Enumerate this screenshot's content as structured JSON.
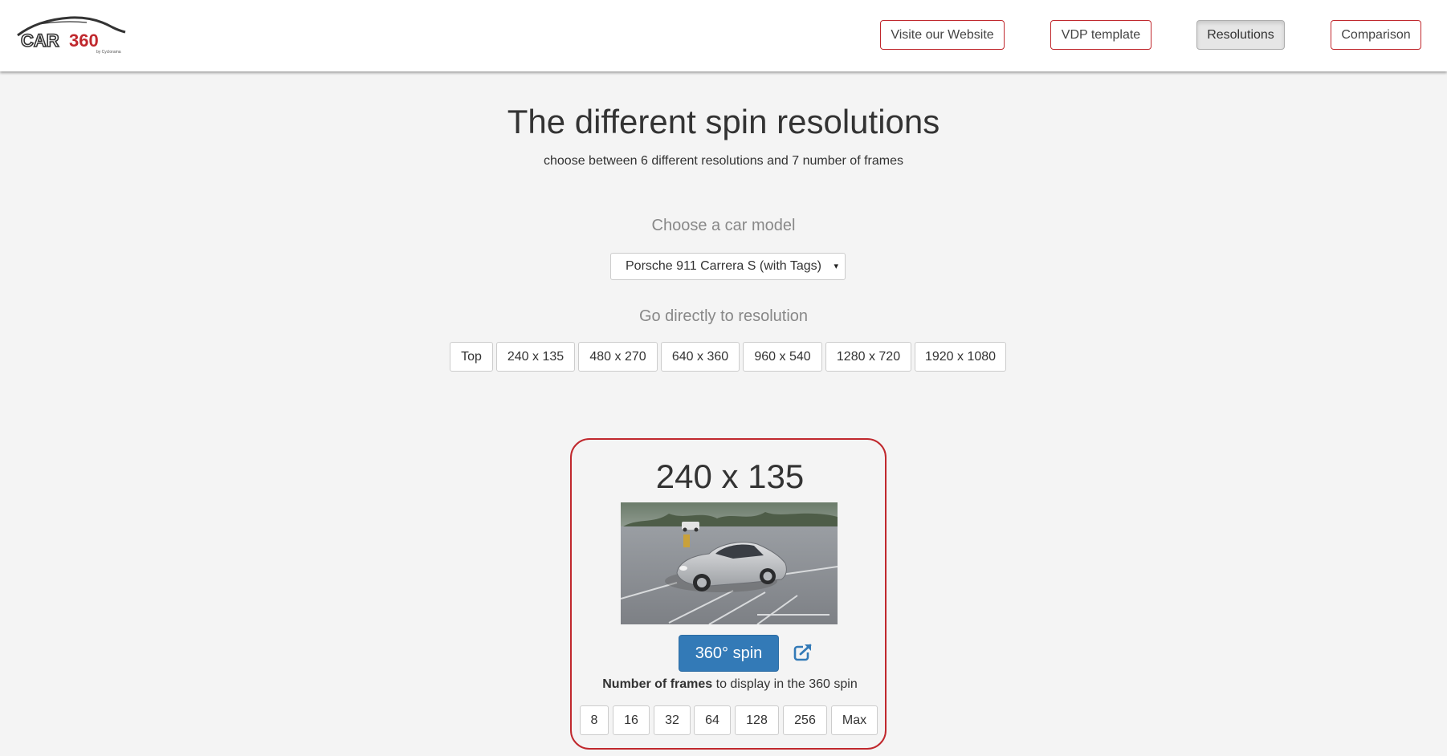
{
  "header": {
    "logo": {
      "text_car": "CAR",
      "text_360": "360",
      "byline": "by Cyclorama",
      "colors": {
        "dark": "#333333",
        "red": "#c0282d"
      }
    },
    "nav": [
      {
        "label": "Visite our Website",
        "active": false
      },
      {
        "label": "VDP template",
        "active": false
      },
      {
        "label": "Resolutions",
        "active": true
      },
      {
        "label": "Comparison",
        "active": false
      }
    ]
  },
  "main": {
    "title": "The different spin resolutions",
    "subtitle": "choose between 6 different resolutions and 7 number of frames",
    "model_label": "Choose a car model",
    "model_select": {
      "value": "Porsche 911 Carrera S (with Tags)",
      "arrow": "▾"
    },
    "resolution_label": "Go directly to resolution",
    "resolution_buttons": [
      "Top",
      "240 x 135",
      "480 x 270",
      "640 x 360",
      "960 x 540",
      "1280 x 720",
      "1920 x 1080"
    ]
  },
  "card": {
    "title": "240 x 135",
    "image_alt": "Silver Porsche 911 in a parking lot",
    "spin_button": "360° spin",
    "external_link_icon": "external-link-icon",
    "frames_bold": "Number of frames",
    "frames_rest": " to display in the 360 spin",
    "frame_buttons": [
      "8",
      "16",
      "32",
      "64",
      "128",
      "256",
      "Max"
    ]
  },
  "colors": {
    "accent_red": "#c0282d",
    "primary_blue": "#337ab7",
    "background": "#f4f4f4"
  }
}
